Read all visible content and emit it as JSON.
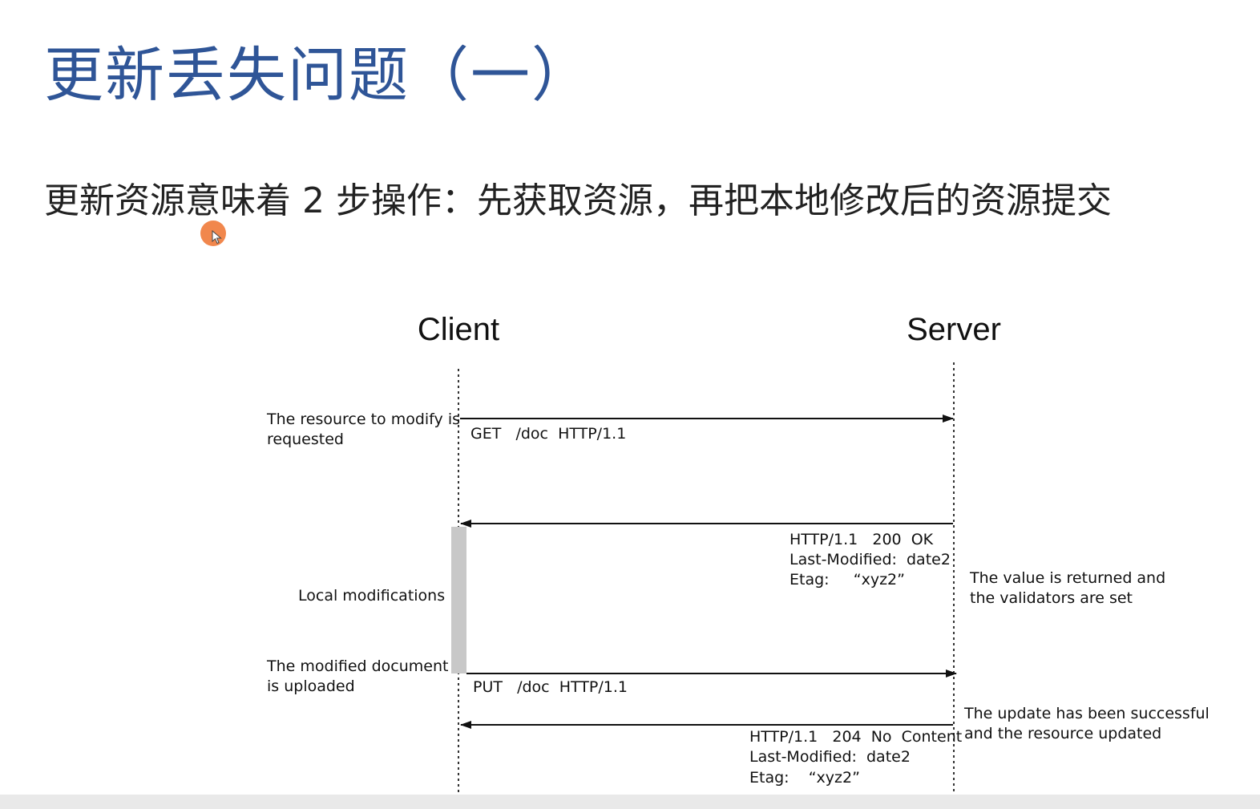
{
  "slide": {
    "title": "更新丢失问题（一）",
    "subtitle": "更新资源意味着 2 步操作：先获取资源，再把本地修改后的资源提交",
    "title_color": "#2f5597"
  },
  "diagram": {
    "client_label": "Client",
    "server_label": "Server",
    "left_notes": [
      "The resource to modify is",
      "requested",
      "Local modifications",
      "The modified document",
      "is uploaded"
    ],
    "right_notes": [
      "The value is returned and",
      "the validators are set",
      "The update has been successful",
      "and the resource updated"
    ],
    "messages": {
      "get_request": "GET   /doc  HTTP/1.1",
      "response1": [
        "HTTP/1.1   200  OK",
        "Last-Modified:  date2",
        "Etag:     “xyz2”"
      ],
      "put_request": "PUT   /doc  HTTP/1.1",
      "response2": [
        "HTTP/1.1   204  No  Content",
        "Last-Modified:  date2",
        "Etag:    “xyz2”"
      ]
    },
    "local_mod_bar_color": "#c8c8c8"
  },
  "icons": {
    "cursor": "cursor-arrow-icon",
    "cursor_highlight_color": "#f07a3a"
  }
}
